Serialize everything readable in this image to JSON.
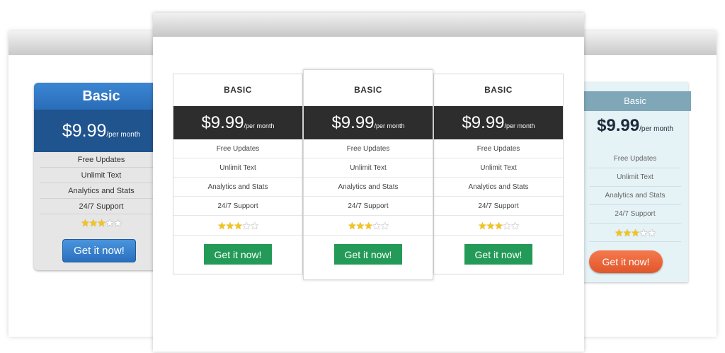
{
  "left_card": {
    "title": "Basic",
    "price": "$9.99",
    "period": "/per month",
    "features": [
      "Free Updates",
      "Unlimit Text",
      "Analytics and Stats",
      "24/7 Support"
    ],
    "rating": 3,
    "rating_max": 5,
    "cta": "Get it now!",
    "accent": "#2a6db8"
  },
  "center_cards": [
    {
      "title": "BASIC",
      "price": "$9.99",
      "period": "/per month",
      "features": [
        "Free Updates",
        "Unlimit Text",
        "Analytics and Stats",
        "24/7 Support"
      ],
      "rating": 3,
      "rating_max": 5,
      "cta": "Get it now!"
    },
    {
      "title": "BASIC",
      "price": "$9.99",
      "period": "/per month",
      "features": [
        "Free Updates",
        "Unlimit Text",
        "Analytics and Stats",
        "24/7 Support"
      ],
      "rating": 3,
      "rating_max": 5,
      "cta": "Get it now!"
    },
    {
      "title": "BASIC",
      "price": "$9.99",
      "period": "/per month",
      "features": [
        "Free Updates",
        "Unlimit Text",
        "Analytics and Stats",
        "24/7 Support"
      ],
      "rating": 3,
      "rating_max": 5,
      "cta": "Get it now!"
    }
  ],
  "right_card": {
    "title": "Basic",
    "price": "$9.99",
    "period": "/per month",
    "features": [
      "Free Updates",
      "Unlimit Text",
      "Analytics and Stats",
      "24/7 Support"
    ],
    "rating": 3,
    "rating_max": 5,
    "cta": "Get it now!",
    "accent": "#e0562a"
  },
  "colors": {
    "dark_header": "#2d2d2d",
    "green_button": "#239a57",
    "star_on": "#f4c417"
  }
}
